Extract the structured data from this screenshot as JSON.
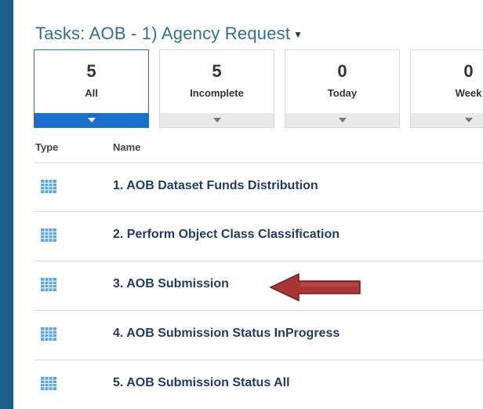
{
  "header": {
    "title": "Tasks: AOB - 1) Agency Request",
    "dropdown_icon": "caret-down-icon"
  },
  "filters": [
    {
      "count": "5",
      "label": "All",
      "active": true
    },
    {
      "count": "5",
      "label": "Incomplete",
      "active": false
    },
    {
      "count": "0",
      "label": "Today",
      "active": false
    },
    {
      "count": "0",
      "label": "Week",
      "active": false
    }
  ],
  "table": {
    "columns": [
      "Type",
      "Name"
    ],
    "rows": [
      {
        "icon": "grid-icon",
        "name": "1. AOB Dataset Funds Distribution"
      },
      {
        "icon": "grid-icon",
        "name": "2. Perform Object Class Classification"
      },
      {
        "icon": "grid-icon",
        "name": "3. AOB Submission"
      },
      {
        "icon": "grid-icon",
        "name": "4. AOB Submission Status InProgress"
      },
      {
        "icon": "grid-icon",
        "name": "5. AOB Submission Status All"
      }
    ]
  },
  "annotation": {
    "icon": "arrow-left-icon",
    "color": "#a83434"
  },
  "colors": {
    "sidebar": "#1f5d8c",
    "title": "#2d6e9e",
    "active_tile": "#1a6fcc",
    "task_name": "#1f3b6b"
  }
}
